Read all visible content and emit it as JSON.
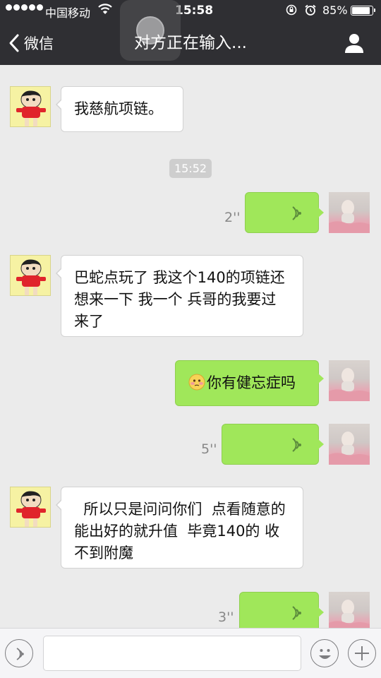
{
  "status_bar": {
    "carrier": "中国移动",
    "time": "15:58",
    "battery_percent": "85%",
    "battery_level": 0.85,
    "icons": [
      "signal-icon",
      "wifi-icon",
      "rotation-lock-icon",
      "alarm-icon",
      "battery-icon"
    ]
  },
  "nav": {
    "back_label": "微信",
    "title": "对方正在输入...",
    "right_icon": "contact-profile-icon"
  },
  "chat": {
    "timestamp": "15:52",
    "messages": [
      {
        "side": "left",
        "type": "text",
        "text": "我慈航项链。"
      },
      {
        "side": "right",
        "type": "voice",
        "duration": "2''"
      },
      {
        "side": "left",
        "type": "text",
        "text": "巴蛇点玩了  我这个140的项链还想来一下   我一个 兵哥的我要过来了"
      },
      {
        "side": "right",
        "type": "text",
        "emoji": "blush-face-emoji",
        "text": "你有健忘症吗"
      },
      {
        "side": "right",
        "type": "voice",
        "duration": "5''"
      },
      {
        "side": "left",
        "type": "text",
        "text": "  所以只是问问你们  点看随意的  能出好的就升值  毕竟140的 收不到附魔"
      },
      {
        "side": "right",
        "type": "voice",
        "duration": "3''"
      }
    ]
  },
  "input_bar": {
    "text_value": "",
    "icons": [
      "voice-mode-icon",
      "emoji-icon",
      "plus-icon"
    ]
  },
  "colors": {
    "nav_background": "#2f2f33",
    "chat_background": "#ebebeb",
    "outgoing_bubble": "#a0e75a",
    "incoming_bubble": "#ffffff"
  }
}
